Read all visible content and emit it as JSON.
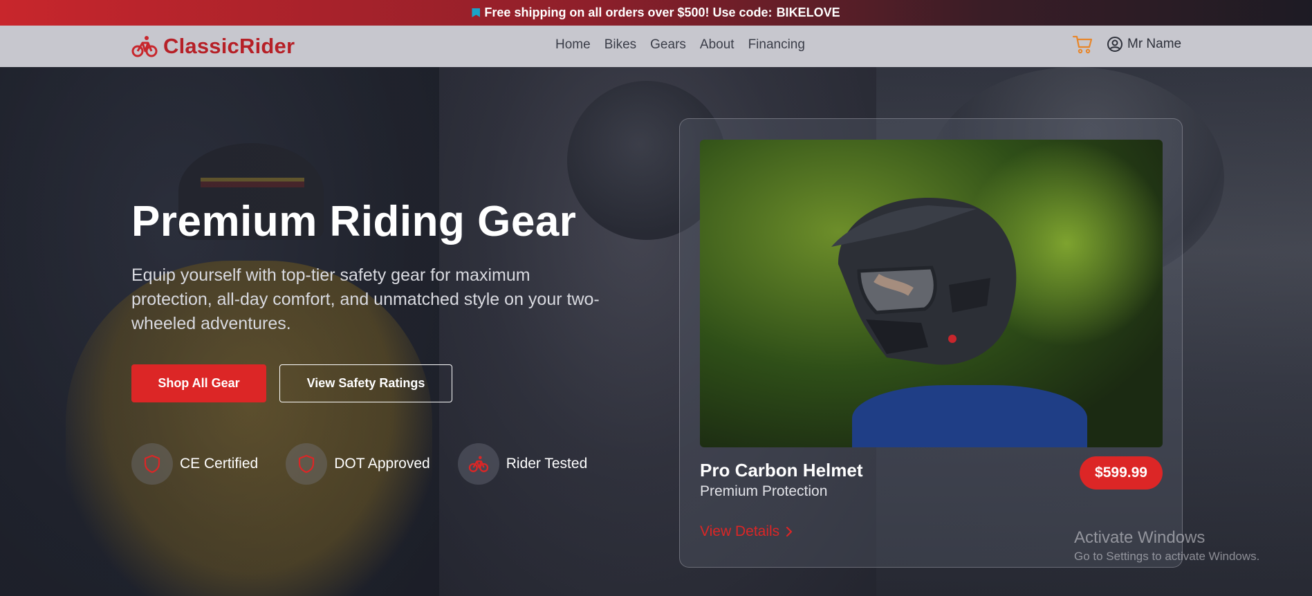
{
  "announcement": {
    "text": "Free shipping on all orders over $500! Use code:",
    "code": "BIKELOVE",
    "icon": "bookmark-flag-icon"
  },
  "brand": {
    "name": "ClassicRider",
    "icon": "bicycle-icon",
    "color": "#b62027"
  },
  "nav": {
    "links": [
      "Home",
      "Bikes",
      "Gears",
      "About",
      "Financing"
    ],
    "cart_icon": "shopping-cart-icon",
    "user_icon": "user-circle-icon",
    "user_name": "Mr Name"
  },
  "hero": {
    "title": "Premium Riding Gear",
    "description": "Equip yourself with top-tier safety gear for maximum protection, all-day comfort, and unmatched style on your two-wheeled adventures.",
    "primary_button": "Shop All Gear",
    "secondary_button": "View Safety Ratings",
    "badges": [
      {
        "label": "CE Certified",
        "icon": "shield-icon"
      },
      {
        "label": "DOT Approved",
        "icon": "shield-icon"
      },
      {
        "label": "Rider Tested",
        "icon": "bicycle-icon"
      }
    ]
  },
  "product": {
    "name": "Pro Carbon Helmet",
    "subtitle": "Premium Protection",
    "price": "$599.99",
    "link_text": "View Details",
    "link_icon": "chevron-right-icon"
  },
  "watermark": {
    "title": "Activate Windows",
    "subtitle": "Go to Settings to activate Windows."
  },
  "colors": {
    "accent": "#dc2626",
    "cart": "#e8862a"
  }
}
